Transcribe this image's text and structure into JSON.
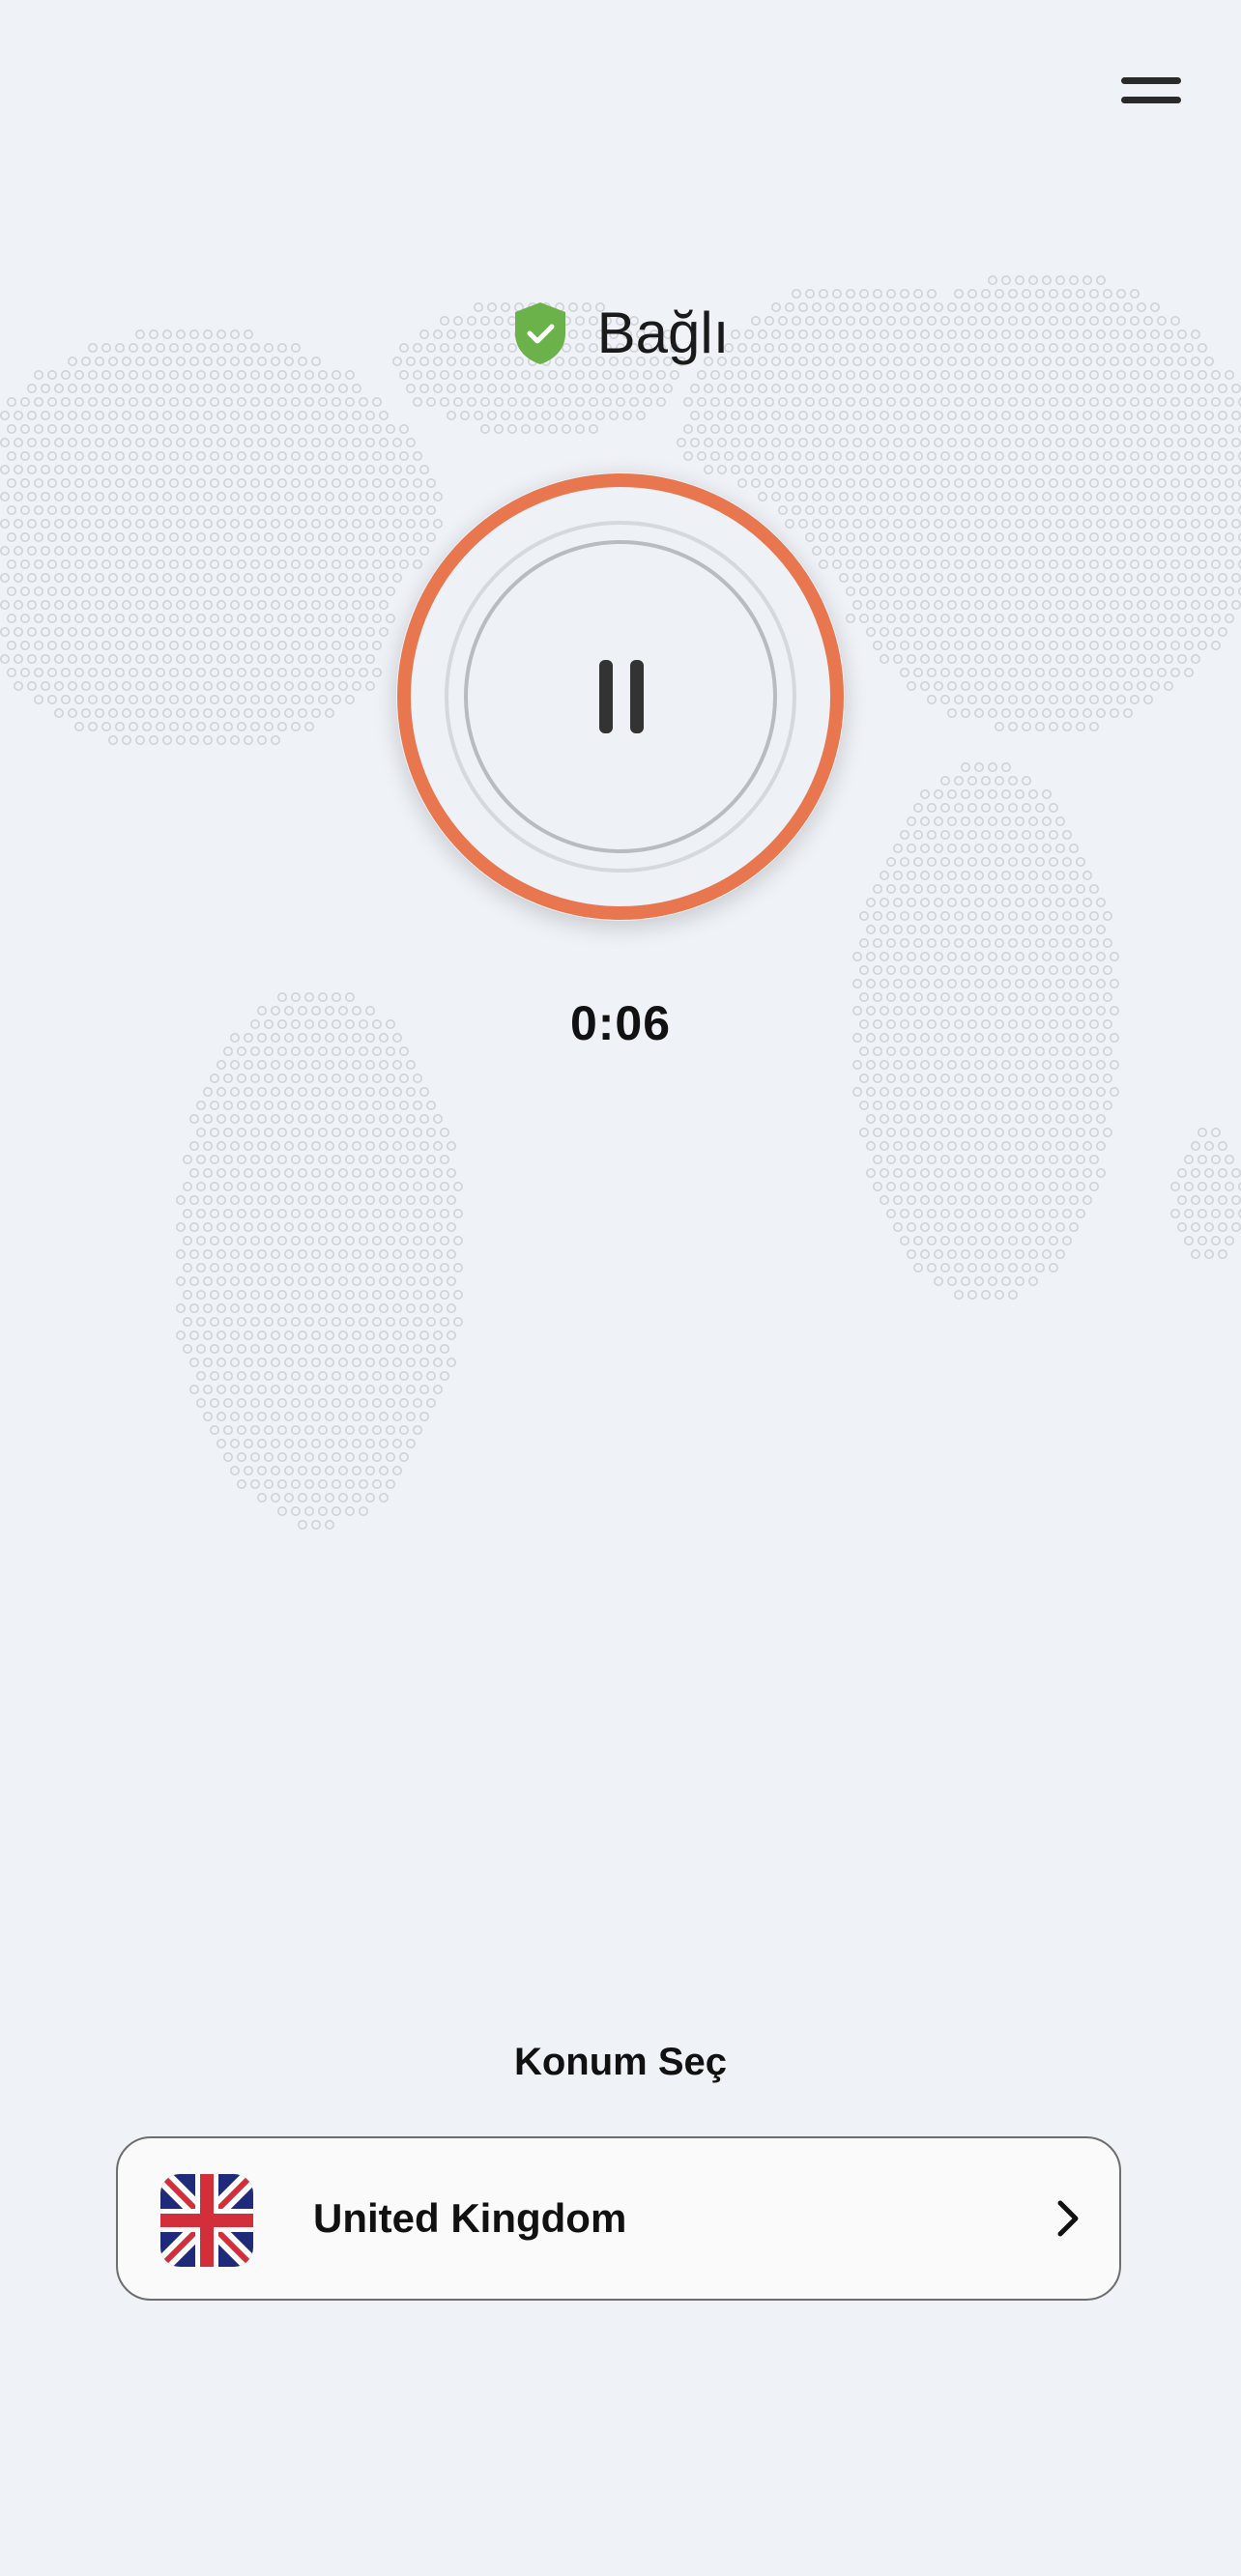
{
  "header": {
    "menu_icon": "hamburger-menu-icon"
  },
  "status": {
    "icon": "shield-check-icon",
    "label": "Bağlı",
    "color": "#6bb24a"
  },
  "connect_button": {
    "icon": "pause-icon",
    "accent_color": "#e8774f"
  },
  "timer": {
    "value": "0:06"
  },
  "location": {
    "section_label": "Konum Seç",
    "country": "United Kingdom",
    "flag_icon": "uk-flag-icon",
    "chevron_icon": "chevron-right-icon"
  }
}
